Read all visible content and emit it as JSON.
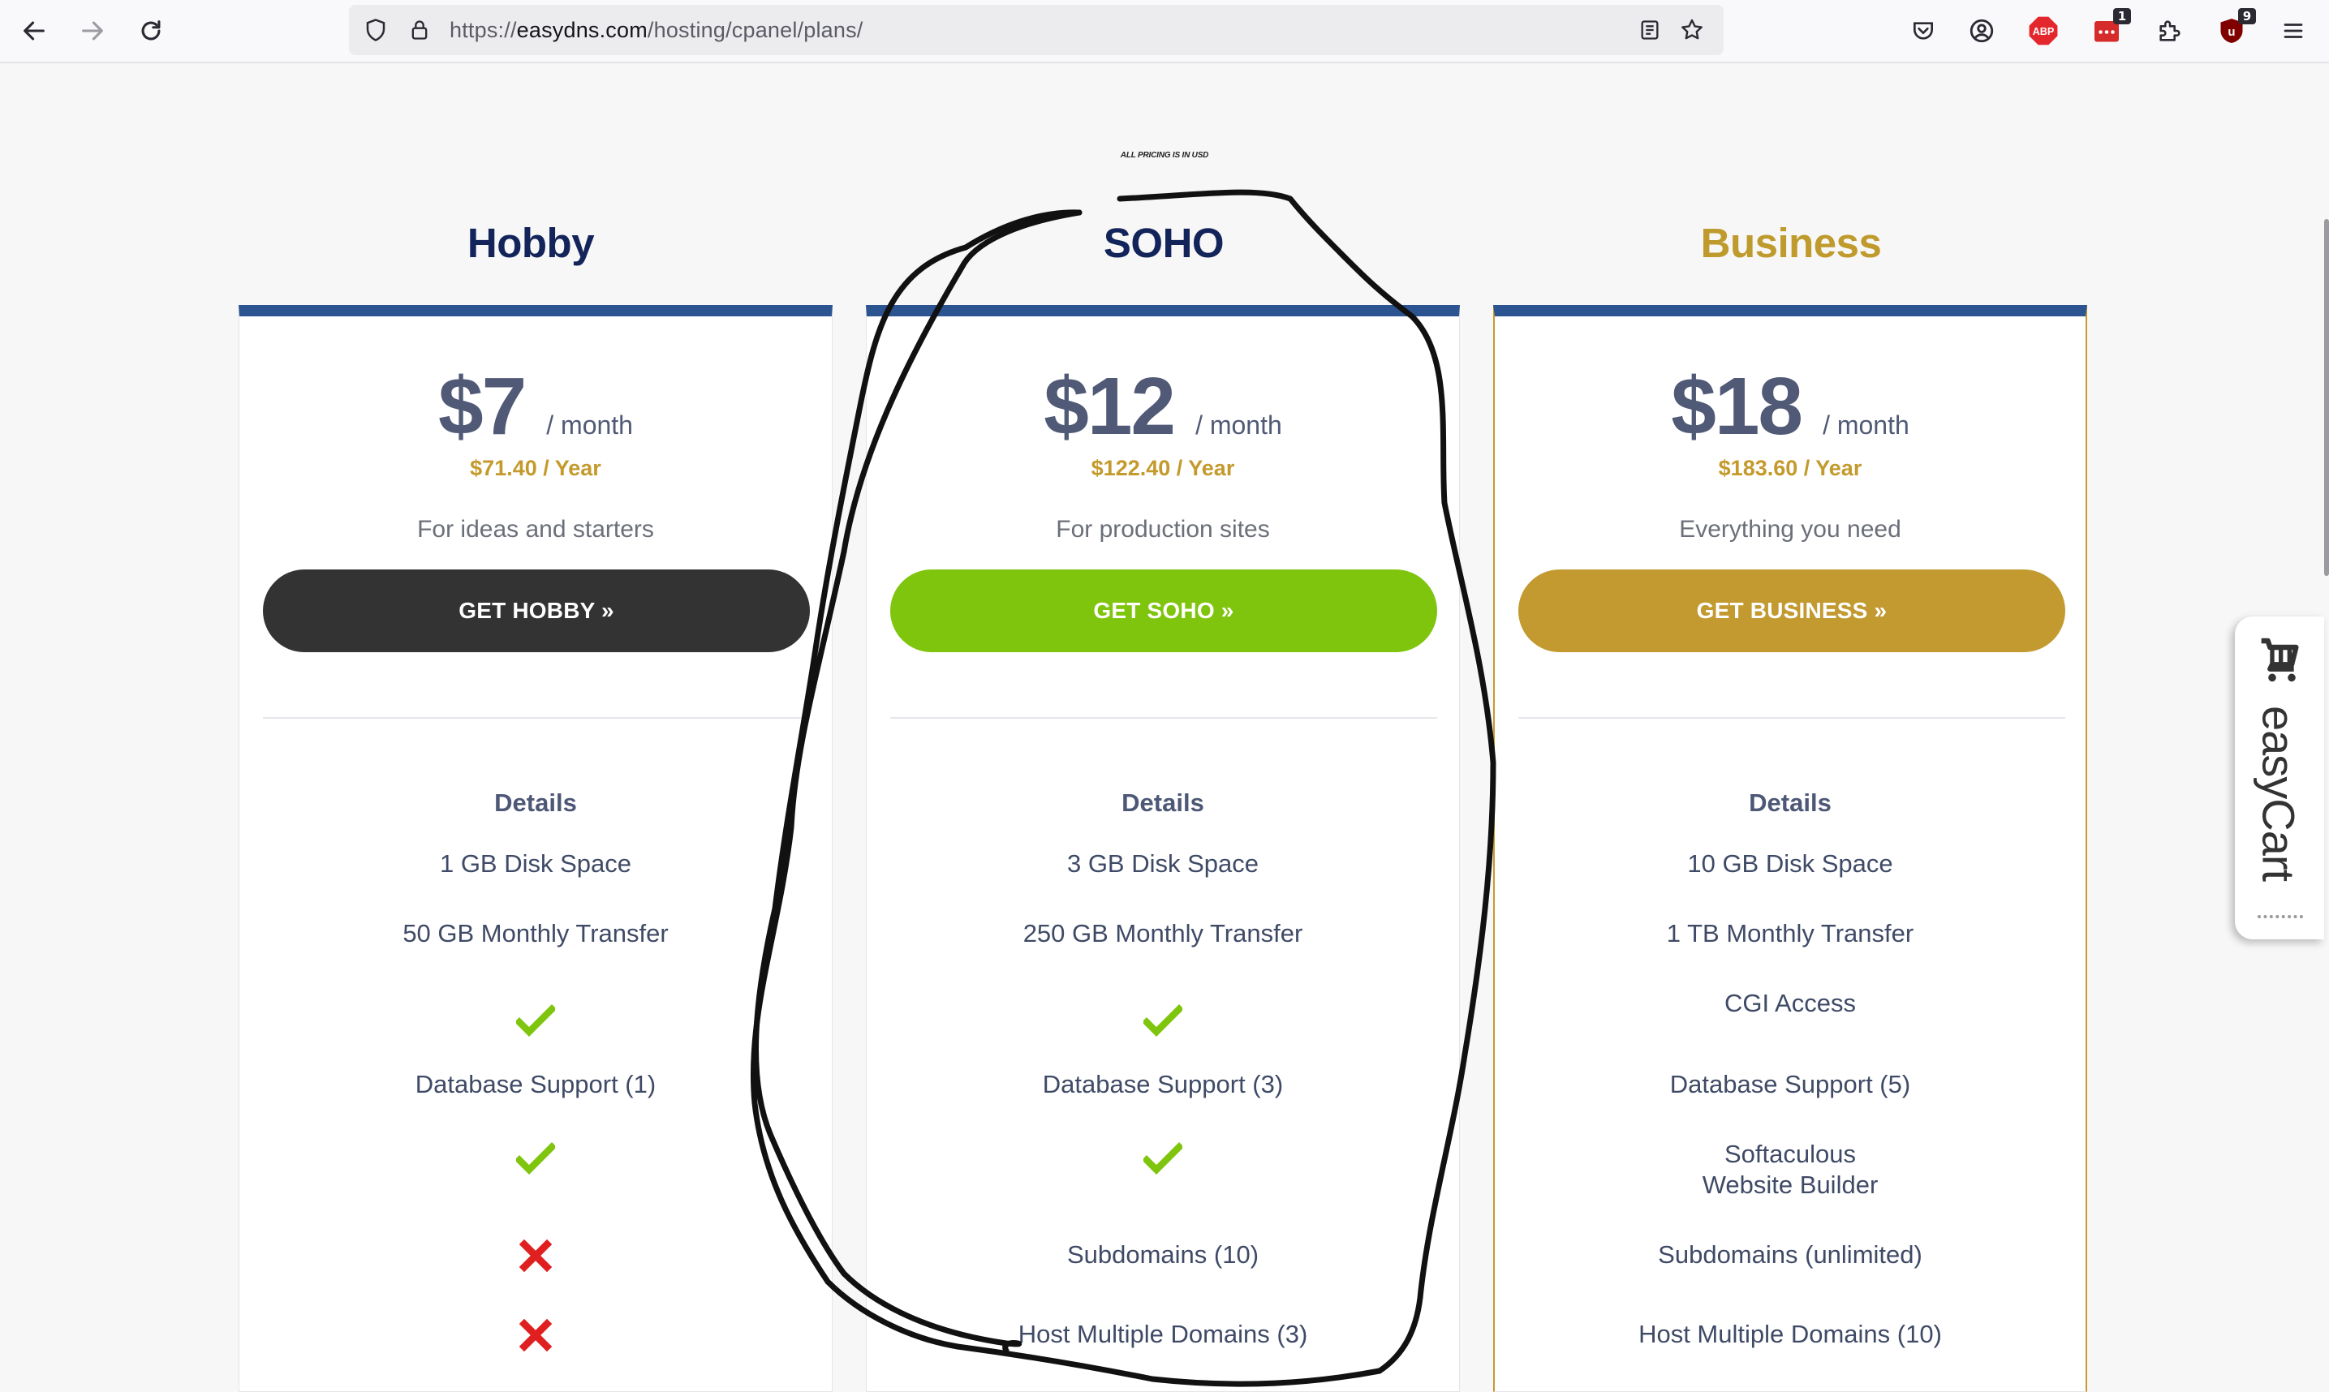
{
  "browser": {
    "url_prefix": "https://",
    "url_domain": "easydns.com",
    "url_path": "/hosting/cpanel/plans/",
    "extensions": [
      {
        "icon": "pocket-icon"
      },
      {
        "icon": "account-icon"
      },
      {
        "icon": "adblock-icon",
        "label": "ABP"
      },
      {
        "icon": "extension-red-icon",
        "badge": "1"
      },
      {
        "icon": "puzzle-icon"
      },
      {
        "icon": "ublock-icon",
        "badge": "9"
      },
      {
        "icon": "menu-icon"
      }
    ]
  },
  "page": {
    "pricing_note": "ALL PRICING IS IN USD",
    "plans": [
      {
        "name": "Hobby",
        "name_color": "#13245a",
        "price": "$7",
        "unit": "/ month",
        "yearly": "$71.40 / Year",
        "tagline": "For ideas and starters",
        "cta": "GET HOBBY »",
        "cta_color": "#333333",
        "details_heading": "Details",
        "features": {
          "disk": "1 GB Disk Space",
          "transfer": "50 GB Monthly Transfer",
          "cgi": "check",
          "database": "Database Support (1)",
          "builder": "check",
          "subdomains": "cross",
          "domains": "cross"
        }
      },
      {
        "name": "SOHO",
        "name_color": "#13245a",
        "price": "$12",
        "unit": "/ month",
        "yearly": "$122.40 / Year",
        "tagline": "For production sites",
        "cta": "GET SOHO »",
        "cta_color": "#7fc50d",
        "details_heading": "Details",
        "features": {
          "disk": "3 GB Disk Space",
          "transfer": "250 GB Monthly Transfer",
          "cgi": "check",
          "database": "Database Support (3)",
          "builder": "check",
          "subdomains": "Subdomains (10)",
          "domains": "Host Multiple Domains (3)"
        }
      },
      {
        "name": "Business",
        "name_color": "#bf9a2c",
        "price": "$18",
        "unit": "/ month",
        "yearly": "$183.60 / Year",
        "tagline": "Everything you need",
        "cta": "GET BUSINESS »",
        "cta_color": "#c29a30",
        "details_heading": "Details",
        "features": {
          "disk": "10 GB Disk Space",
          "transfer": "1 TB Monthly Transfer",
          "cgi": "CGI Access",
          "database": "Database Support (5)",
          "builder_line1": "Softaculous",
          "builder_line2": "Website Builder",
          "subdomains": "Subdomains (unlimited)",
          "domains": "Host Multiple Domains (10)"
        }
      }
    ],
    "cart_widget": {
      "label": "easyCart",
      "icon": "cart-icon"
    },
    "colors": {
      "accent_blue": "#2c5491",
      "check_green": "#7fc50d",
      "cross_red": "#e02020",
      "gold": "#c49a2c"
    }
  }
}
